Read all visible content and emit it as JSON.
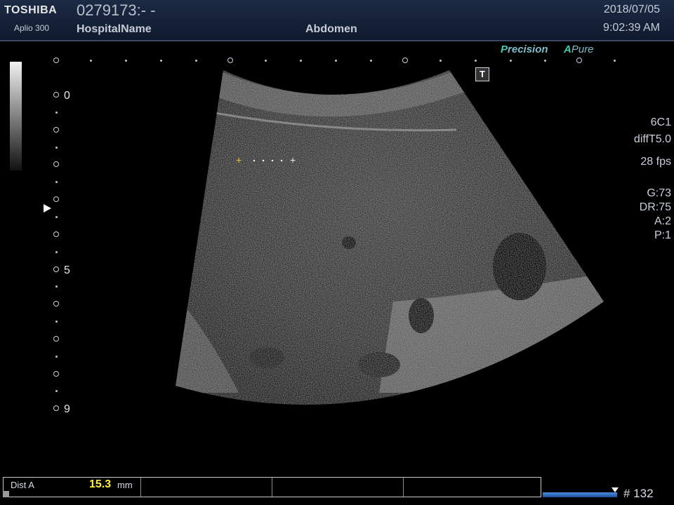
{
  "header": {
    "brand": "TOSHIBA",
    "model": "Aplio 300",
    "patient_id": "0279173:- -",
    "hospital": "HospitalName",
    "exam": "Abdomen",
    "date": "2018/07/05",
    "time": "9:02:39 AM"
  },
  "modes": {
    "precision_prefix": "P",
    "precision_rest": "recision",
    "apure_prefix": "A",
    "apure_rest": "Pure"
  },
  "marker_t": "T",
  "depth_scale": {
    "labels": [
      "0",
      "5",
      "9"
    ]
  },
  "params": {
    "probe": "6C1",
    "preset": "diffT5.0",
    "fps": "28 fps",
    "gain": "G:73",
    "dynamic_range": "DR:75",
    "a": "A:2",
    "p": "P:1"
  },
  "measurement": {
    "label": "Dist A",
    "value": "15.3",
    "unit": "mm"
  },
  "cine": {
    "frame": "# 132"
  },
  "colors": {
    "accent": "#48c9b0",
    "measure_value": "#ffee3a",
    "caliper": "#e8c23a"
  }
}
